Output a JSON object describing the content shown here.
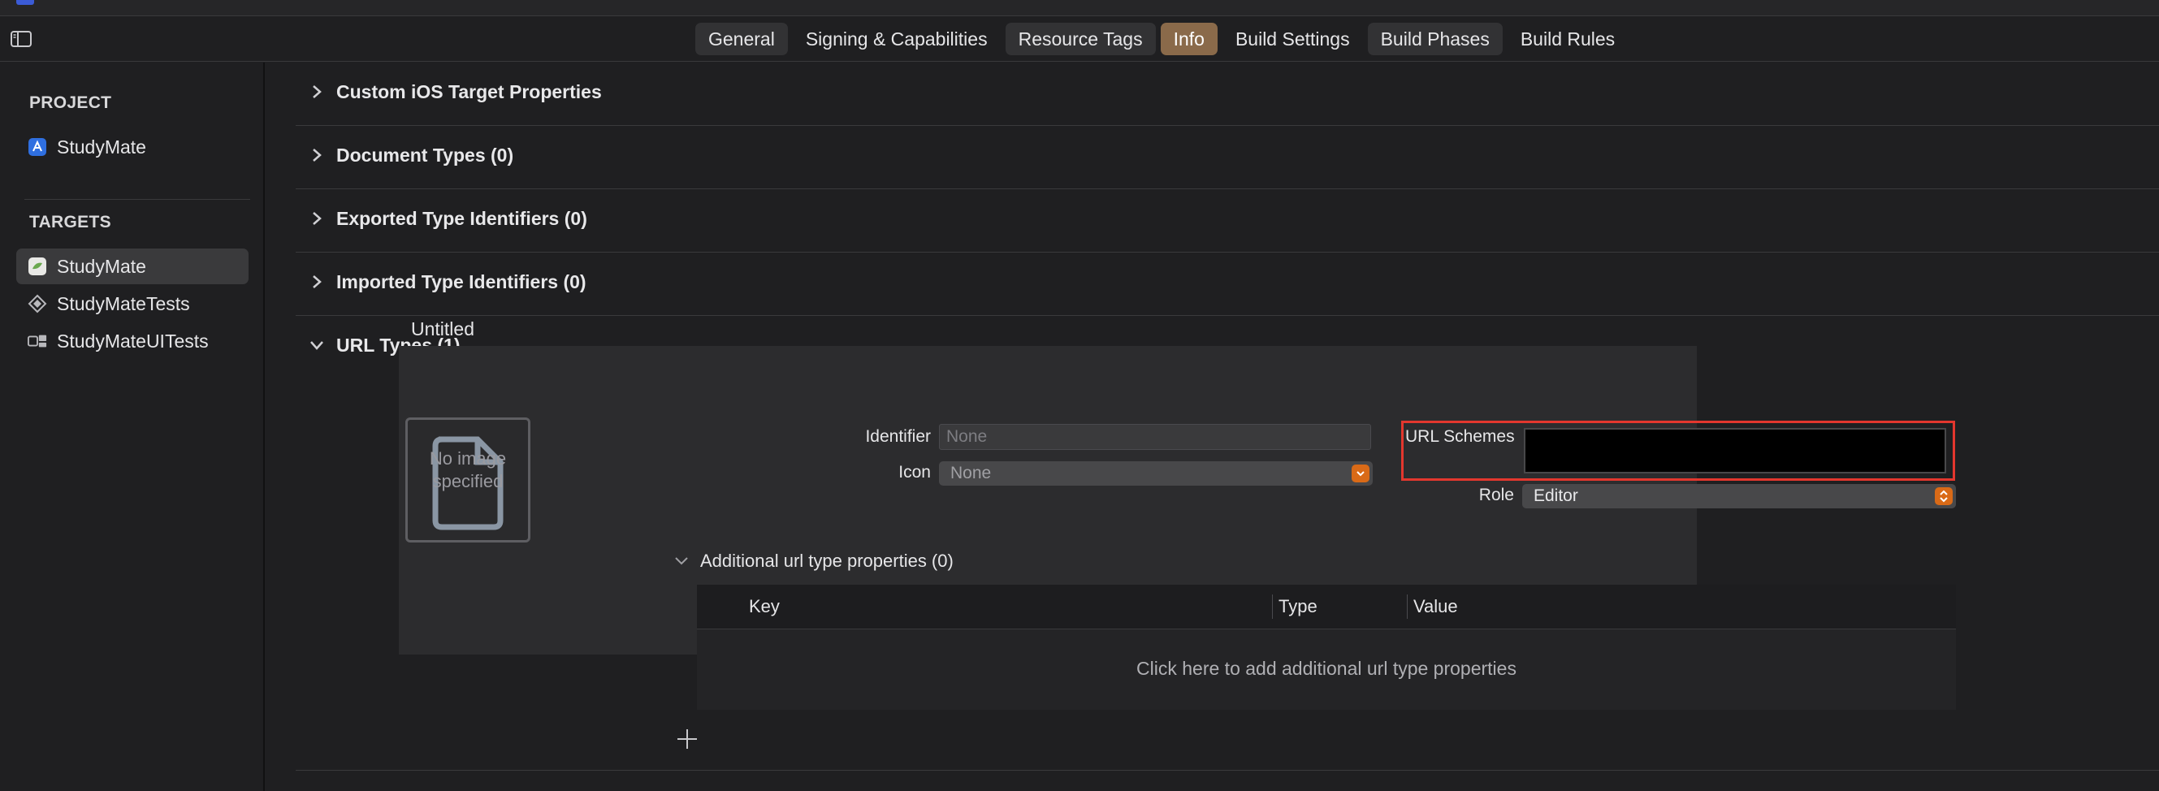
{
  "tabs": [
    {
      "label": "General",
      "style": "boxed"
    },
    {
      "label": "Signing & Capabilities",
      "style": "plain"
    },
    {
      "label": "Resource Tags",
      "style": "boxed"
    },
    {
      "label": "Info",
      "style": "active"
    },
    {
      "label": "Build Settings",
      "style": "plain"
    },
    {
      "label": "Build Phases",
      "style": "boxed"
    },
    {
      "label": "Build Rules",
      "style": "plain"
    }
  ],
  "sidebar": {
    "project_title": "PROJECT",
    "project_item": "StudyMate",
    "targets_title": "TARGETS",
    "targets": [
      {
        "label": "StudyMate",
        "icon": "app-target-icon",
        "selected": true
      },
      {
        "label": "StudyMateTests",
        "icon": "test-target-icon",
        "selected": false
      },
      {
        "label": "StudyMateUITests",
        "icon": "ui-test-target-icon",
        "selected": false
      }
    ]
  },
  "sections": [
    {
      "label": "Custom iOS Target Properties",
      "expanded": false
    },
    {
      "label": "Document Types (0)",
      "expanded": false
    },
    {
      "label": "Exported Type Identifiers (0)",
      "expanded": false
    },
    {
      "label": "Imported Type Identifiers (0)",
      "expanded": false
    },
    {
      "label": "URL Types (1)",
      "expanded": true
    }
  ],
  "url_type": {
    "title": "Untitled",
    "image_placeholder": "No image specified",
    "identifier_label": "Identifier",
    "identifier_placeholder": "None",
    "icon_label": "Icon",
    "icon_value": "None",
    "url_schemes_label": "URL Schemes",
    "url_schemes_value": "",
    "role_label": "Role",
    "role_value": "Editor",
    "additional_label": "Additional url type properties (0)",
    "table_columns": [
      "Key",
      "Type",
      "Value"
    ],
    "table_empty_text": "Click here to add additional url type properties"
  },
  "colors": {
    "accent_active_tab": "#8a6a4a",
    "highlight_box": "#e3372e",
    "popup_stepper": "#d96a17"
  }
}
